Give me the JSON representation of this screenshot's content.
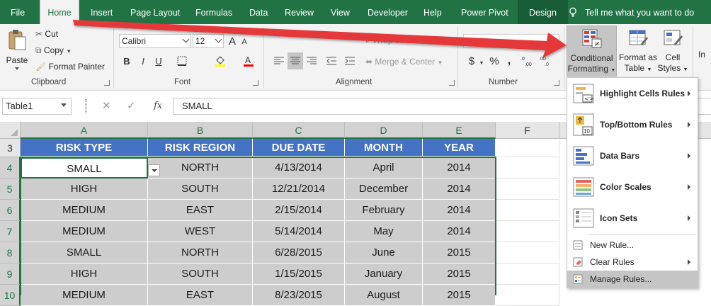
{
  "colors": {
    "excel_green": "#217346",
    "table_header": "#4472c4",
    "cell_fill": "#cdcdcd",
    "arrow_red": "#e5383b"
  },
  "tabs": [
    {
      "label": "File"
    },
    {
      "label": "Home"
    },
    {
      "label": "Insert"
    },
    {
      "label": "Page Layout"
    },
    {
      "label": "Formulas"
    },
    {
      "label": "Data"
    },
    {
      "label": "Review"
    },
    {
      "label": "View"
    },
    {
      "label": "Developer"
    },
    {
      "label": "Help"
    },
    {
      "label": "Power Pivot"
    },
    {
      "label": "Design"
    }
  ],
  "tell_me": "Tell me what you want to do",
  "clipboard": {
    "paste": "Paste",
    "cut": "Cut",
    "copy": "Copy",
    "format_painter": "Format Painter",
    "label": "Clipboard"
  },
  "font": {
    "name": "Calibri",
    "size": "12",
    "bold": "B",
    "italic": "I",
    "underline": "U",
    "label": "Font"
  },
  "alignment": {
    "wrap_text": "Wrap Text",
    "merge_center": "Merge & Center",
    "label": "Alignment"
  },
  "number": {
    "currency": "$",
    "percent": "%",
    "comma": ",",
    "label": "Number"
  },
  "styles": {
    "conditional_formatting": [
      "Conditional",
      "Formatting"
    ],
    "format_as_table": [
      "Format as",
      "Table"
    ],
    "cell_styles": [
      "Cell",
      "Styles"
    ],
    "insert": "In"
  },
  "formula_bar": {
    "name_box": "Table1",
    "fx": "fx",
    "content": "SMALL"
  },
  "columns": [
    "A",
    "B",
    "C",
    "D",
    "E",
    "F"
  ],
  "rows": [
    "3",
    "4",
    "5",
    "6",
    "7",
    "8",
    "9",
    "10"
  ],
  "table": {
    "headers": [
      "RISK TYPE",
      "RISK REGION",
      "DUE DATE",
      "MONTH",
      "YEAR"
    ],
    "rows": [
      [
        "SMALL",
        "NORTH",
        "4/13/2014",
        "April",
        "2014"
      ],
      [
        "HIGH",
        "SOUTH",
        "12/21/2014",
        "December",
        "2014"
      ],
      [
        "MEDIUM",
        "EAST",
        "2/15/2014",
        "February",
        "2014"
      ],
      [
        "MEDIUM",
        "WEST",
        "5/14/2014",
        "May",
        "2014"
      ],
      [
        "SMALL",
        "NORTH",
        "6/28/2015",
        "June",
        "2015"
      ],
      [
        "HIGH",
        "SOUTH",
        "1/15/2015",
        "January",
        "2015"
      ],
      [
        "MEDIUM",
        "EAST",
        "8/23/2015",
        "August",
        "2015"
      ]
    ]
  },
  "menu": {
    "highlight_cells_rules": "Highlight Cells Rules",
    "top_bottom_rules": "Top/Bottom Rules",
    "data_bars": "Data Bars",
    "color_scales": "Color Scales",
    "icon_sets": "Icon Sets",
    "new_rule": "New Rule...",
    "clear_rules": "Clear Rules",
    "manage_rules": "Manage Rules..."
  }
}
